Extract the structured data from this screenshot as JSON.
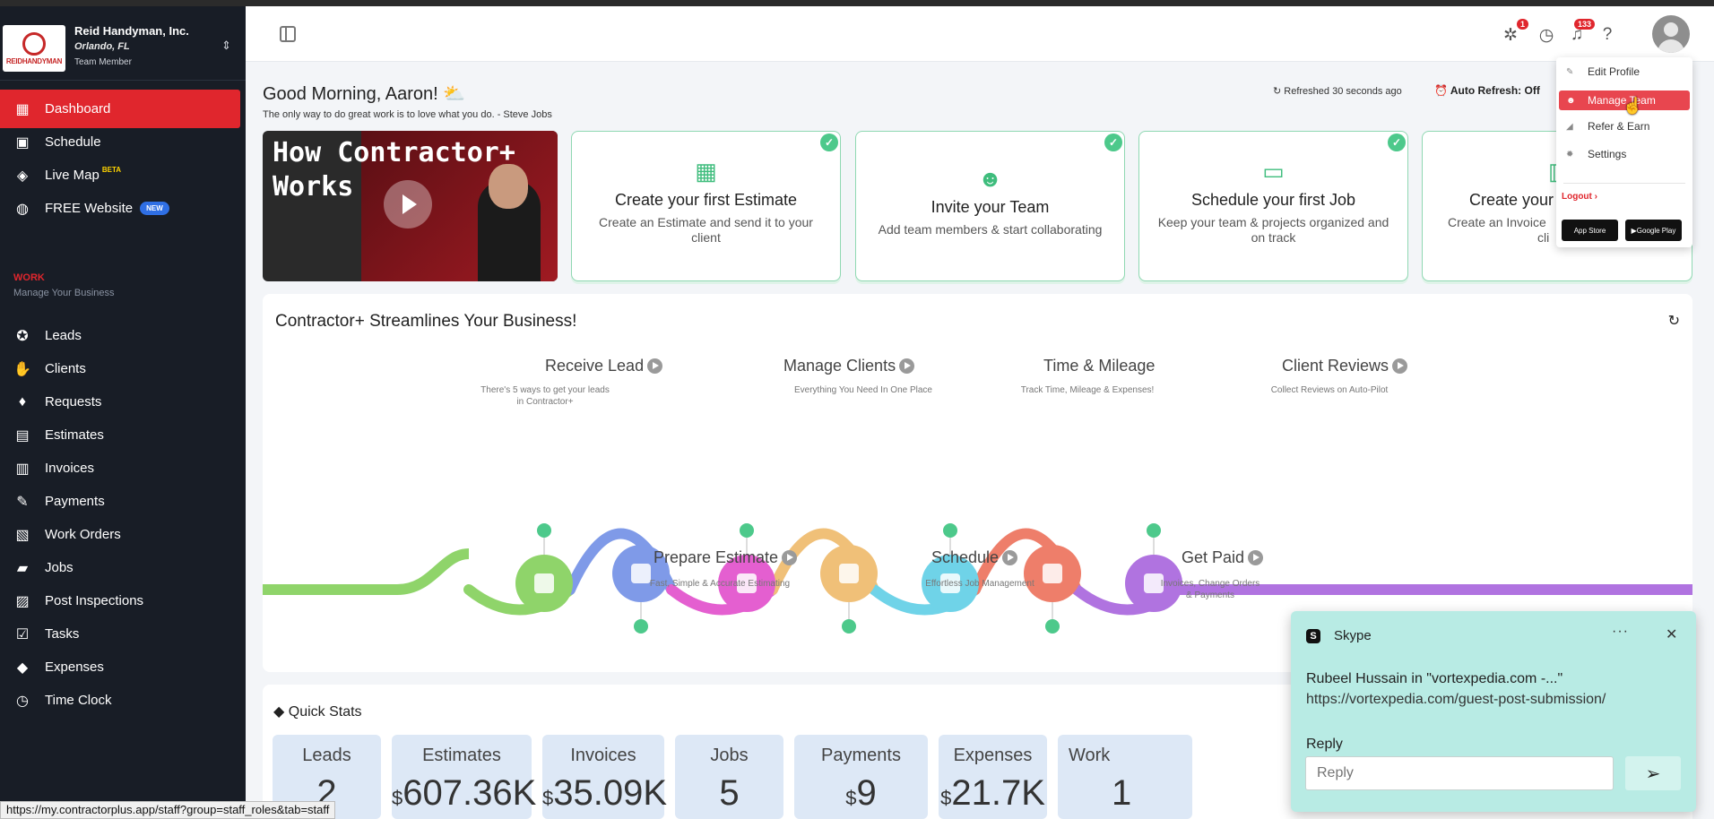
{
  "org": {
    "name": "Reid Handyman, Inc.",
    "location": "Orlando, FL",
    "role": "Team Member",
    "logo_text": "REIDHANDYMAN"
  },
  "nav": {
    "items": [
      {
        "label": "Dashboard",
        "icon": "dashboard-icon"
      },
      {
        "label": "Schedule",
        "icon": "calendar-icon"
      },
      {
        "label": "Live Map",
        "icon": "map-icon",
        "badge": "BETA"
      },
      {
        "label": "FREE Website",
        "icon": "globe-icon",
        "badge": "NEW"
      }
    ],
    "section_title": "WORK",
    "section_sub": "Manage Your Business",
    "work_items": [
      {
        "label": "Leads",
        "icon": "medal-icon"
      },
      {
        "label": "Clients",
        "icon": "handshake-icon"
      },
      {
        "label": "Requests",
        "icon": "request-icon"
      },
      {
        "label": "Estimates",
        "icon": "calculator-icon"
      },
      {
        "label": "Invoices",
        "icon": "invoice-icon"
      },
      {
        "label": "Payments",
        "icon": "payment-icon"
      },
      {
        "label": "Work Orders",
        "icon": "clipboard-icon"
      },
      {
        "label": "Jobs",
        "icon": "briefcase-icon"
      },
      {
        "label": "Post Inspections",
        "icon": "inspection-icon"
      },
      {
        "label": "Tasks",
        "icon": "tasks-icon"
      },
      {
        "label": "Expenses",
        "icon": "expenses-icon"
      },
      {
        "label": "Time Clock",
        "icon": "clock-icon"
      }
    ]
  },
  "topbar": {
    "teams_badge": "1",
    "notif_badge": "133"
  },
  "greeting": {
    "title": "Good Morning, Aaron!",
    "emoji": "⛅",
    "quote": "The only way to do great work is to love what you do. - Steve Jobs",
    "refreshed": "Refreshed 30 seconds ago",
    "auto_refresh": "Auto Refresh: Off"
  },
  "video": {
    "title_line1": "How Contractor+",
    "title_line2": "Works"
  },
  "onboarding": [
    {
      "title": "Create your first Estimate",
      "desc": "Create an Estimate and send it to your client",
      "icon": "calculator-icon"
    },
    {
      "title": "Invite your Team",
      "desc": "Add team members & start collaborating",
      "icon": "team-icon"
    },
    {
      "title": "Schedule your first Job",
      "desc": "Keep your team & projects organized and on track",
      "icon": "briefcase-icon"
    },
    {
      "title": "Create your",
      "desc": "Create an Invoice",
      "desc2": "cli",
      "icon": "invoice-icon"
    }
  ],
  "streamline": {
    "title": "Contractor+ Streamlines Your Business!",
    "steps_top": [
      {
        "title": "Receive Lead",
        "sub": "There's 5 ways to get your leads in Contractor+"
      },
      {
        "title": "Manage Clients",
        "sub": "Everything You Need In One Place"
      },
      {
        "title": "Time & Mileage",
        "sub": "Track Time, Mileage & Expenses!"
      },
      {
        "title": "Client Reviews",
        "sub": "Collect Reviews on Auto-Pilot"
      }
    ],
    "steps_bottom": [
      {
        "title": "Prepare Estimate",
        "sub": "Fast, Simple & Accurate Estimating"
      },
      {
        "title": "Schedule",
        "sub": "Effortless Job Management"
      },
      {
        "title": "Get Paid",
        "sub": "Invoices, Change Orders & Payments"
      }
    ],
    "colors": [
      "#8fd46a",
      "#7f9ae8",
      "#e45fd0",
      "#f0c078",
      "#6fd3e8",
      "#ee7e6a",
      "#b073e0"
    ]
  },
  "quick_stats": {
    "title": "Quick Stats",
    "items": [
      {
        "label": "Leads",
        "prefix": "",
        "value": "2"
      },
      {
        "label": "Estimates",
        "prefix": "$",
        "value": "607.36K"
      },
      {
        "label": "Invoices",
        "prefix": "$",
        "value": "35.09K"
      },
      {
        "label": "Jobs",
        "prefix": "",
        "value": "5"
      },
      {
        "label": "Payments",
        "prefix": "$",
        "value": "9"
      },
      {
        "label": "Expenses",
        "prefix": "$",
        "value": "21.7K"
      },
      {
        "label": "Work",
        "prefix": "",
        "value": "1"
      }
    ]
  },
  "profile_menu": {
    "items": [
      "Edit Profile",
      "Manage Team",
      "Refer & Earn",
      "Settings"
    ],
    "logout": "Logout",
    "app_store": "App Store",
    "google_play": "Google Play"
  },
  "skype": {
    "app": "Skype",
    "line1": "Rubeel Hussain in \"vortexpedia.com -...\"",
    "line2": "https://vortexpedia.com/guest-post-submission/",
    "reply_label": "Reply",
    "reply_placeholder": "Reply"
  },
  "status_url": "https://my.contractorplus.app/staff?group=staff_roles&tab=staff"
}
